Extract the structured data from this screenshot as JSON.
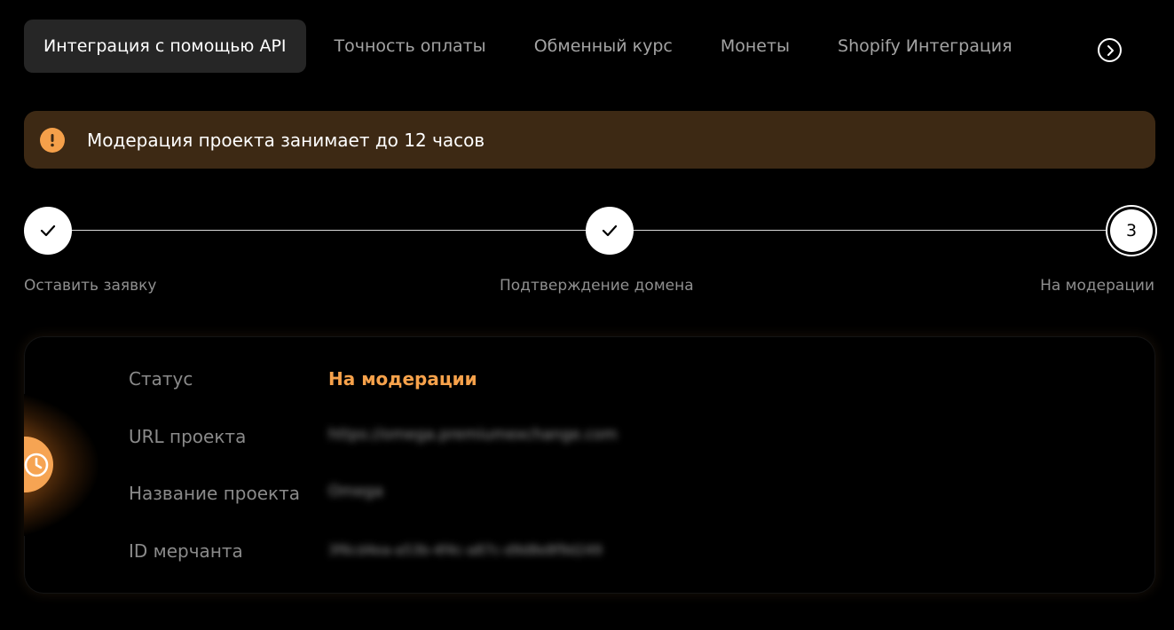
{
  "tabs": [
    {
      "label": "Интеграция с помощью API",
      "active": true
    },
    {
      "label": "Точность оплаты",
      "active": false
    },
    {
      "label": "Обменный курс",
      "active": false
    },
    {
      "label": "Монеты",
      "active": false
    },
    {
      "label": "Shopify Интеграция",
      "active": false
    }
  ],
  "notice": {
    "icon": "exclamation-icon",
    "text": "Модерация проекта занимает до 12 часов"
  },
  "steps": [
    {
      "label": "Оставить заявку",
      "state": "done"
    },
    {
      "label": "Подтверждение домена",
      "state": "done"
    },
    {
      "label": "На модерации",
      "state": "current",
      "number": "3"
    }
  ],
  "project": {
    "status_label": "Статус",
    "status_value": "На модерации",
    "url_label": "URL проекта",
    "url_value": "https://omega.premiumexchange.com",
    "name_label": "Название проекта",
    "name_value": "Omega",
    "merchant_label": "ID мерчанта",
    "merchant_value": "3f6cd4ea-a53b-4f4c-a87c-d9d8e8f9d249"
  },
  "colors": {
    "accent": "#f7a24b",
    "notice_bg": "#3d2914",
    "active_tab_bg": "#262626"
  }
}
